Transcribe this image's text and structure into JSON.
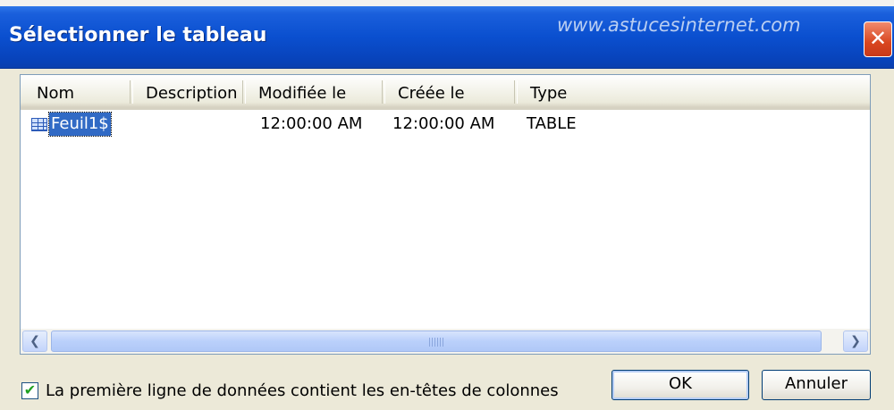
{
  "window": {
    "title": "Sélectionner le tableau",
    "watermark": "www.astucesinternet.com",
    "close_icon": "close-icon",
    "title_bar_color": "#0a4fcf"
  },
  "list": {
    "columns": [
      "Nom",
      "Description",
      "Modifiée le",
      "Créée le",
      "Type"
    ],
    "rows": [
      {
        "icon": "table-icon",
        "name": "Feuil1$",
        "description": "",
        "modified": "12:00:00 AM",
        "created": "12:00:00 AM",
        "type": "TABLE",
        "selected": true
      }
    ],
    "scroll_left_icon": "arrow-left-icon",
    "scroll_right_icon": "arrow-right-icon"
  },
  "options": {
    "header_checkbox_label": "La première ligne de données contient les en-têtes de colonnes",
    "header_checkbox_checked": true
  },
  "buttons": {
    "ok_label": "OK",
    "cancel_label": "Annuler"
  }
}
